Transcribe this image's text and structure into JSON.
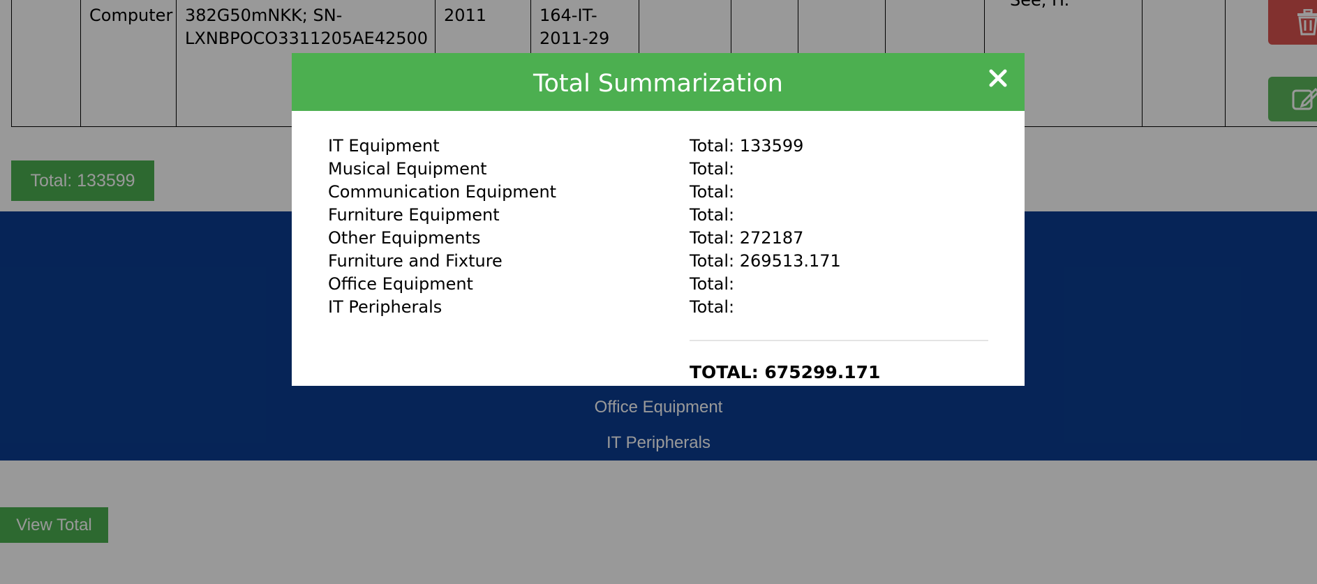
{
  "table_row": {
    "category": "Computer",
    "serial_line1": "382G50mNKK; SN-",
    "serial_line2": "LXNBPOCO3311205AE42500",
    "year": "2011",
    "code_line1": "164-IT-",
    "code_line2": "2011-29",
    "cut_text": "See, H."
  },
  "category_total_button": "Total: 133599",
  "nav": {
    "items": [
      "Office Equipment",
      "IT Peripherals"
    ]
  },
  "view_total_button": "View Total",
  "modal": {
    "title": "Total Summarization",
    "close_icon": "close-icon",
    "categories": [
      {
        "name": "IT Equipment",
        "total": "Total: 133599"
      },
      {
        "name": "Musical Equipment",
        "total": "Total:"
      },
      {
        "name": "Communication Equipment",
        "total": "Total:"
      },
      {
        "name": "Furniture Equipment",
        "total": "Total:"
      },
      {
        "name": "Other Equipments",
        "total": "Total: 272187"
      },
      {
        "name": "Furniture and Fixture",
        "total": "Total: 269513.171"
      },
      {
        "name": "Office Equipment",
        "total": "Total:"
      },
      {
        "name": "IT Peripherals",
        "total": "Total:"
      }
    ],
    "grand_total": "TOTAL: 675299.171"
  },
  "colors": {
    "header_green": "#4caf50",
    "navy": "#0a3d91",
    "delete_red": "#d9534f",
    "edit_green": "#5cb85c"
  }
}
